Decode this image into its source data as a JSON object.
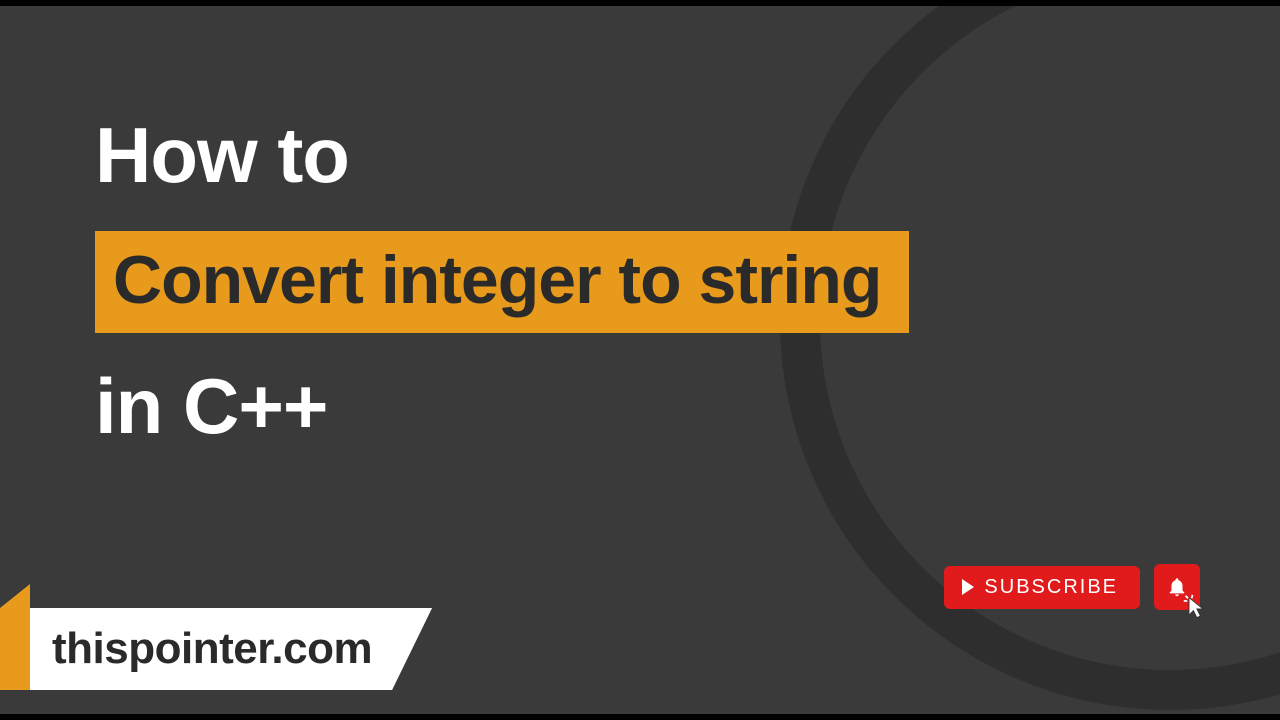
{
  "title": {
    "line1": "How to",
    "highlight": "Convert integer to string",
    "line3": "in C++"
  },
  "banner": {
    "site": "thispointer.com"
  },
  "subscribe": {
    "label": "SUBSCRIBE"
  }
}
